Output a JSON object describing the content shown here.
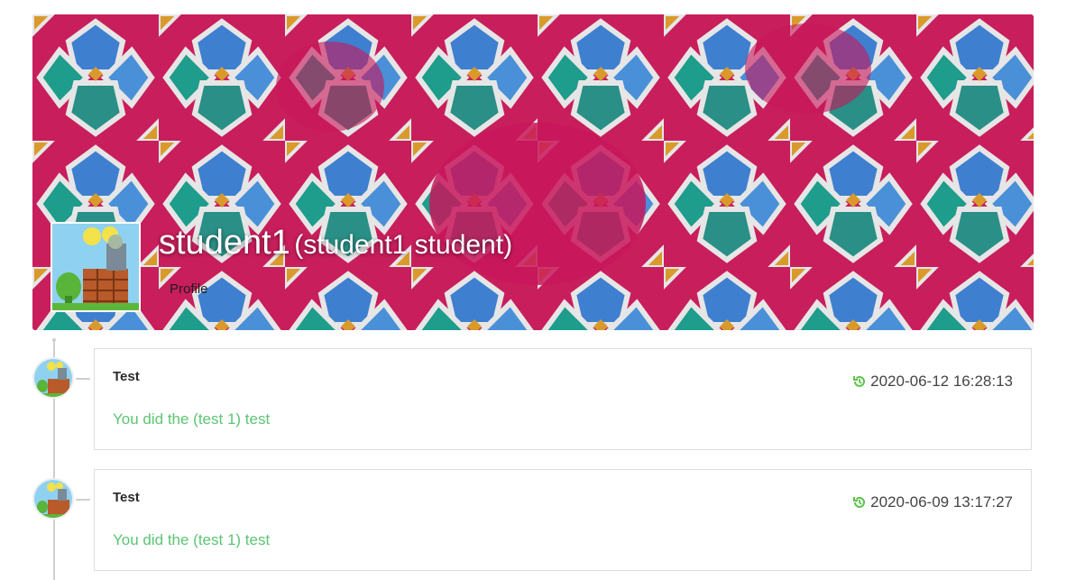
{
  "profile": {
    "username": "student1",
    "fullname_display": "(student1 student)",
    "profile_link": "Profile"
  },
  "colors": {
    "accent_green": "#5cc574",
    "clock_green": "#5cc24c",
    "banner_magenta": "#c81e5c",
    "tile_blue": "#3f7fd0",
    "tile_teal": "#1e9c8c",
    "tile_gold": "#d99a2b"
  },
  "activities": [
    {
      "title": "Test",
      "timestamp": "2020-06-12 16:28:13",
      "message": "You did the (test 1) test",
      "icon": "history-clock-icon"
    },
    {
      "title": "Test",
      "timestamp": "2020-06-09 13:17:27",
      "message": "You did the (test 1) test",
      "icon": "history-clock-icon"
    }
  ]
}
